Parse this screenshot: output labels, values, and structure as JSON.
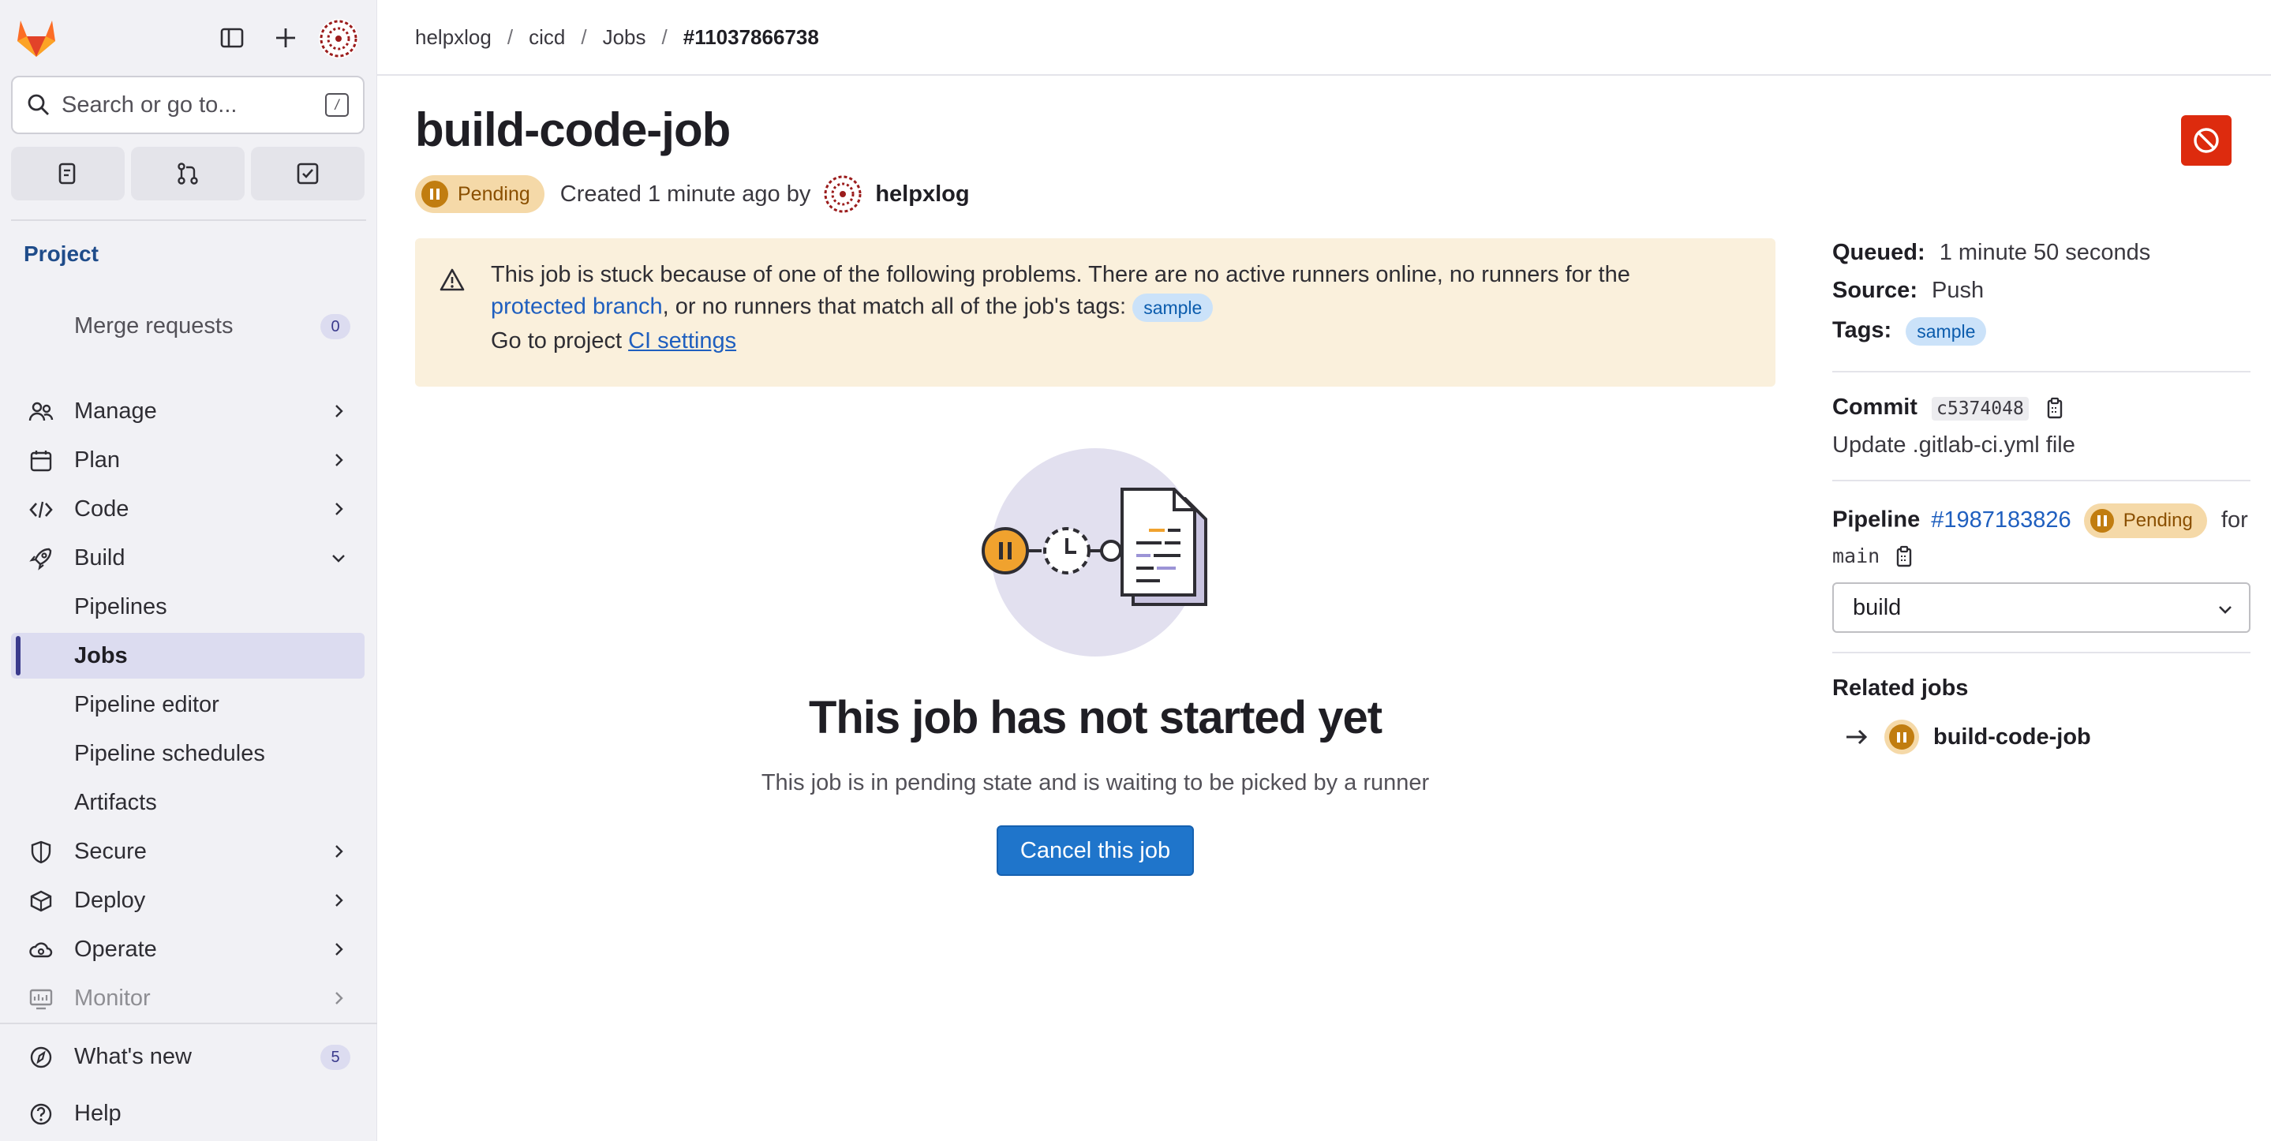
{
  "sidebar": {
    "search_placeholder": "Search or go to...",
    "search_shortcut": "/",
    "section_title": "Project",
    "merge_requests": {
      "label": "Merge requests",
      "count": "0"
    },
    "items": [
      {
        "label": "Manage"
      },
      {
        "label": "Plan"
      },
      {
        "label": "Code"
      },
      {
        "label": "Build"
      },
      {
        "label": "Pipelines"
      },
      {
        "label": "Jobs"
      },
      {
        "label": "Pipeline editor"
      },
      {
        "label": "Pipeline schedules"
      },
      {
        "label": "Artifacts"
      },
      {
        "label": "Secure"
      },
      {
        "label": "Deploy"
      },
      {
        "label": "Operate"
      },
      {
        "label": "Monitor"
      }
    ],
    "whats_new": {
      "label": "What's new",
      "count": "5"
    },
    "help": {
      "label": "Help"
    }
  },
  "breadcrumb": [
    "helpxlog",
    "cicd",
    "Jobs",
    "#11037866738"
  ],
  "job": {
    "title": "build-code-job",
    "status": "Pending",
    "created_text": "Created 1 minute ago by",
    "author": "helpxlog"
  },
  "alert": {
    "line1": "This job is stuck because of one of the following problems. There are no active runners online, no runners for the",
    "link_protected": "protected branch",
    "line2_rest": ", or no runners that match all of the job's tags:",
    "tag": "sample",
    "line3_prefix": "Go to project",
    "link_ci": "CI settings"
  },
  "empty_state": {
    "title": "This job has not started yet",
    "description": "This job is in pending state and is waiting to be picked by a runner",
    "button": "Cancel this job"
  },
  "details": {
    "queued_label": "Queued:",
    "queued_value": "1 minute 50 seconds",
    "source_label": "Source:",
    "source_value": "Push",
    "tags_label": "Tags:",
    "tag": "sample",
    "commit_label": "Commit",
    "commit_sha": "c5374048",
    "commit_message": "Update .gitlab-ci.yml file",
    "pipeline_label": "Pipeline",
    "pipeline_id": "#1987183826",
    "pipeline_status": "Pending",
    "pipeline_for": "for",
    "branch": "main",
    "stage_select": "build",
    "related_jobs_title": "Related jobs",
    "related_job": "build-code-job"
  },
  "colors": {
    "brand": "#fc6d26",
    "danger": "#dd2b0e",
    "primary": "#1f75cb",
    "pending": "#c17d10",
    "alert_bg": "#faf0dc"
  }
}
